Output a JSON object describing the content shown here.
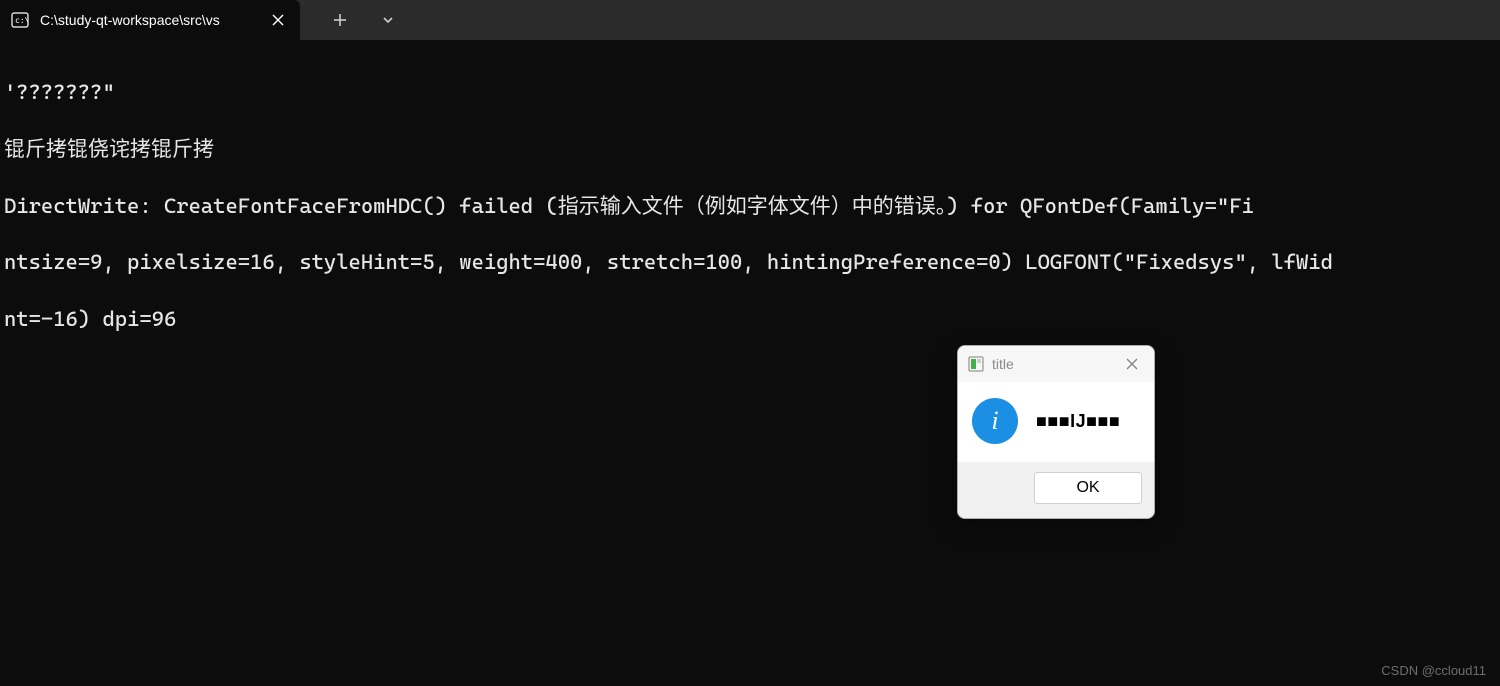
{
  "tabbar": {
    "active_tab_title": "C:\\study-qt-workspace\\src\\vs",
    "new_tab_label": "+",
    "dropdown_label": "˅"
  },
  "terminal": {
    "lines": [
      "'???????\"",
      "锟斤拷锟侥诧拷锟斤拷",
      "DirectWrite: CreateFontFaceFromHDC() failed (指示输入文件（例如字体文件）中的错误。) for QFontDef(Family=\"Fi",
      "ntsize=9, pixelsize=16, styleHint=5, weight=400, stretch=100, hintingPreference=0) LOGFONT(\"Fixedsys\", lfWid",
      "nt=-16) dpi=96"
    ]
  },
  "dialog": {
    "title": "title",
    "message": "■■■IJ■■■",
    "ok_label": "OK"
  },
  "watermark": "CSDN @ccloud11"
}
